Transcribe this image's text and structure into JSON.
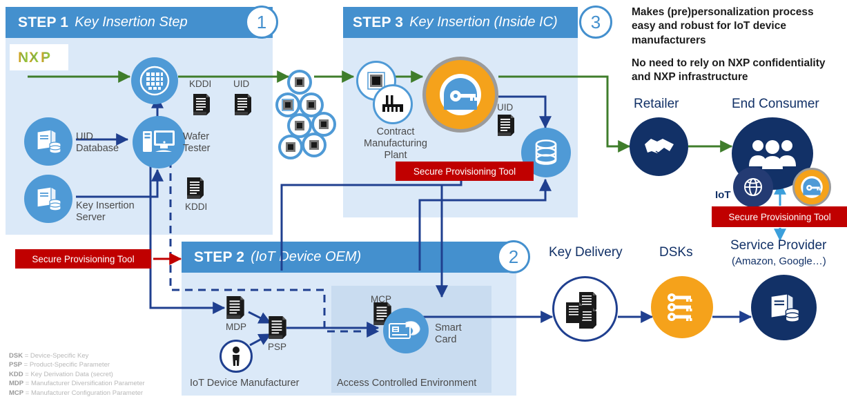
{
  "headline": {
    "line1": "Makes (pre)personalization process easy and robust for IoT device manufacturers",
    "line2": "No need to rely on NXP confidentiality and NXP infrastructure"
  },
  "steps": [
    {
      "id": "step1",
      "strong": "STEP 1",
      "italic": "Key Insertion Step",
      "number": "1"
    },
    {
      "id": "step2",
      "strong": "STEP 2",
      "italic": "(IoT Device OEM)",
      "number": "2"
    },
    {
      "id": "step3",
      "strong": "STEP 3",
      "italic": "Key Insertion (Inside IC)",
      "number": "3"
    }
  ],
  "step1": {
    "logo": "NXP",
    "uid_database": "UID\nDatabase",
    "uid_database_l1": "UID",
    "uid_database_l2": "Database",
    "key_insertion_server_l1": "Key Insertion",
    "key_insertion_server_l2": "Server",
    "wafer_tester_l1": "Wafer",
    "wafer_tester_l2": "Tester",
    "kddi_top": "KDDI",
    "uid_top": "UID",
    "kddi_bottom": "KDDI"
  },
  "step2": {
    "mdp": "MDP",
    "psp": "PSP",
    "mcp": "MCP",
    "smart_card_l1": "Smart",
    "smart_card_l2": "Card",
    "manufacturer": "IoT Device Manufacturer",
    "access_env": "Access Controlled Environment"
  },
  "step3": {
    "plant_l1": "Contract",
    "plant_l2": "Manufacturing",
    "plant_l3": "Plant",
    "uid": "UID"
  },
  "banners": {
    "left": "Secure Provisioning Tool",
    "step3": "Secure Provisioning Tool",
    "right": "Secure Provisioning Tool"
  },
  "right_flow": {
    "retailer": "Retailer",
    "end_consumer": "End Consumer",
    "iot": "IoT",
    "key_delivery": "Key Delivery",
    "dsks": "DSKs",
    "service_provider": "Service Provider",
    "service_provider_sub": "(Amazon,  Google…)"
  },
  "legend": [
    {
      "abbr": "DSK",
      "eq": "=",
      "text": "Device-Specific Key"
    },
    {
      "abbr": "PSP",
      "eq": "=",
      "text": "Product-Specific Parameter"
    },
    {
      "abbr": "KDD",
      "eq": "=",
      "text": "Key Derivation Data (secret)"
    },
    {
      "abbr": "MDP",
      "eq": "=",
      "text": "Manufacturer Diversification Parameter"
    },
    {
      "abbr": "MCP",
      "eq": "=",
      "text": "Manufacturer Configuration Parameter"
    }
  ],
  "colors": {
    "header_blue": "#4490ce",
    "panel_blue": "#dbe9f8",
    "inner_panel_blue": "#c9dcf0",
    "icon_blue": "#4f9ad6",
    "navy": "#123167",
    "line_navy": "#1f3f8f",
    "orange": "#f5a21b",
    "green": "#3f7d2b",
    "red": "#c00000",
    "light_blue_arrow": "#3b9fdb"
  }
}
